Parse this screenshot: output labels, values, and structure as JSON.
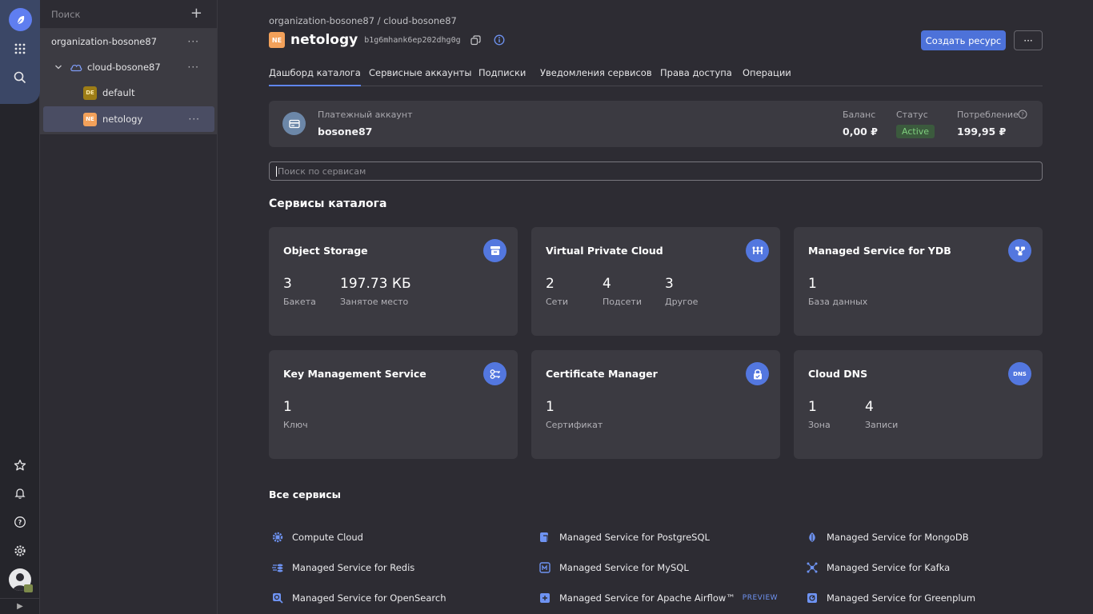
{
  "colors": {
    "accent": "#4d72d9",
    "card_bg": "#3b3a41",
    "page_bg": "#2d2c33",
    "status_active": "#7fcf7e"
  },
  "tree": {
    "search_placeholder": "Поиск",
    "organization": "organization-bosone87",
    "cloud": "cloud-bosone87",
    "folders": [
      {
        "badge": "DE",
        "name": "default"
      },
      {
        "badge": "NE",
        "name": "netology"
      }
    ],
    "more": "···"
  },
  "header": {
    "breadcrumb": "organization-bosone87 / cloud-bosone87",
    "folder_badge": "NE",
    "title": "netology",
    "folder_id": "b1g6mhank6ep202dhg0g",
    "create_button": "Создать ресурс",
    "more_button": "···"
  },
  "tabs": [
    "Дашборд каталога",
    "Сервисные аккаунты",
    "Подписки",
    "Уведомления сервисов",
    "Права доступа",
    "Операции"
  ],
  "billing": {
    "label": "Платежный аккаунт",
    "account": "bosone87",
    "balance_label": "Баланс",
    "balance": "0,00 ₽",
    "status_label": "Статус",
    "status": "Active",
    "usage_label": "Потребление",
    "usage": "199,95 ₽"
  },
  "search": {
    "placeholder": "Поиск по сервисам"
  },
  "catalog_title": "Сервисы каталога",
  "cards": [
    {
      "title": "Object Storage",
      "icon": "storage-icon",
      "metrics": [
        {
          "value": "3",
          "label": "Бакета"
        },
        {
          "value": "197.73 КБ",
          "label": "Занятое место"
        }
      ]
    },
    {
      "title": "Virtual Private Cloud",
      "icon": "network-icon",
      "metrics": [
        {
          "value": "2",
          "label": "Сети"
        },
        {
          "value": "4",
          "label": "Подсети"
        },
        {
          "value": "3",
          "label": "Другое"
        }
      ]
    },
    {
      "title": "Managed Service for YDB",
      "icon": "ydb-icon",
      "metrics": [
        {
          "value": "1",
          "label": "База данных"
        }
      ]
    },
    {
      "title": "Key Management Service",
      "icon": "key-icon",
      "metrics": [
        {
          "value": "1",
          "label": "Ключ"
        }
      ]
    },
    {
      "title": "Certificate Manager",
      "icon": "lock-icon",
      "metrics": [
        {
          "value": "1",
          "label": "Сертификат"
        }
      ]
    },
    {
      "title": "Cloud DNS",
      "icon": "dns-icon",
      "icon_text": "DNS",
      "metrics": [
        {
          "value": "1",
          "label": "Зона"
        },
        {
          "value": "4",
          "label": "Записи"
        }
      ]
    }
  ],
  "all_services_title": "Все сервисы",
  "services": [
    {
      "name": "Compute Cloud",
      "icon": "compute-icon"
    },
    {
      "name": "Managed Service for PostgreSQL",
      "icon": "postgresql-icon"
    },
    {
      "name": "Managed Service for MongoDB",
      "icon": "mongodb-icon"
    },
    {
      "name": "Managed Service for Redis",
      "icon": "redis-icon"
    },
    {
      "name": "Managed Service for MySQL",
      "icon": "mysql-icon"
    },
    {
      "name": "Managed Service for Kafka",
      "icon": "kafka-icon"
    },
    {
      "name": "Managed Service for OpenSearch",
      "icon": "opensearch-icon"
    },
    {
      "name": "Managed Service for Apache Airflow™",
      "icon": "airflow-icon",
      "tag": "PREVIEW"
    },
    {
      "name": "Managed Service for Greenplum",
      "icon": "greenplum-icon"
    }
  ]
}
